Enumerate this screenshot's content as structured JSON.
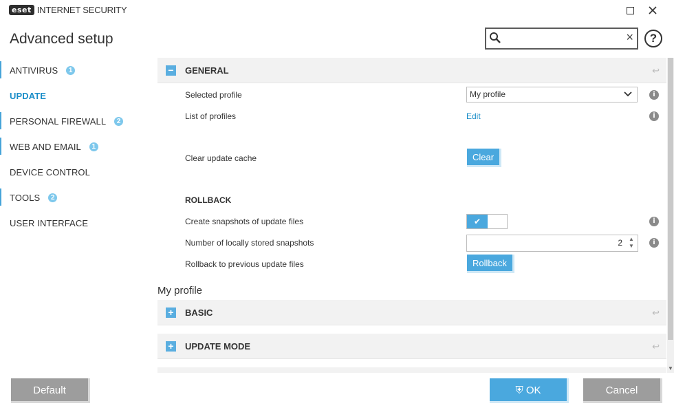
{
  "app": {
    "logo_badge": "eset",
    "logo_text": "INTERNET SECURITY",
    "page_title": "Advanced setup"
  },
  "search": {
    "placeholder": "",
    "value": ""
  },
  "help_symbol": "?",
  "sidebar": {
    "items": [
      {
        "label": "ANTIVIRUS",
        "badge": "1"
      },
      {
        "label": "UPDATE",
        "badge": ""
      },
      {
        "label": "PERSONAL FIREWALL",
        "badge": "2"
      },
      {
        "label": "WEB AND EMAIL",
        "badge": "1"
      },
      {
        "label": "DEVICE CONTROL",
        "badge": ""
      },
      {
        "label": "TOOLS",
        "badge": "2"
      },
      {
        "label": "USER INTERFACE",
        "badge": ""
      }
    ]
  },
  "general": {
    "title": "GENERAL",
    "toggle_symbol": "−",
    "selected_profile_label": "Selected profile",
    "selected_profile_value": "My profile",
    "list_profiles_label": "List of profiles",
    "list_profiles_link": "Edit",
    "clear_cache_label": "Clear update cache",
    "clear_button": "Clear",
    "rollback_heading": "ROLLBACK",
    "snapshots_label": "Create snapshots of update files",
    "snapshots_enabled": true,
    "num_snapshots_label": "Number of locally stored snapshots",
    "num_snapshots_value": "2",
    "rollback_label": "Rollback to previous update files",
    "rollback_button": "Rollback"
  },
  "profile_heading": "My profile",
  "basic": {
    "title": "BASIC",
    "toggle_symbol": "+"
  },
  "update_mode": {
    "title": "UPDATE MODE",
    "toggle_symbol": "+"
  },
  "footer": {
    "default_button": "Default",
    "ok_button": "OK",
    "cancel_button": "Cancel"
  },
  "colors": {
    "accent": "#4aa8de",
    "active_text": "#1a8dc8",
    "badge": "#7ec8ec",
    "neutral_button": "#9d9d9d"
  },
  "info_symbol": "i"
}
